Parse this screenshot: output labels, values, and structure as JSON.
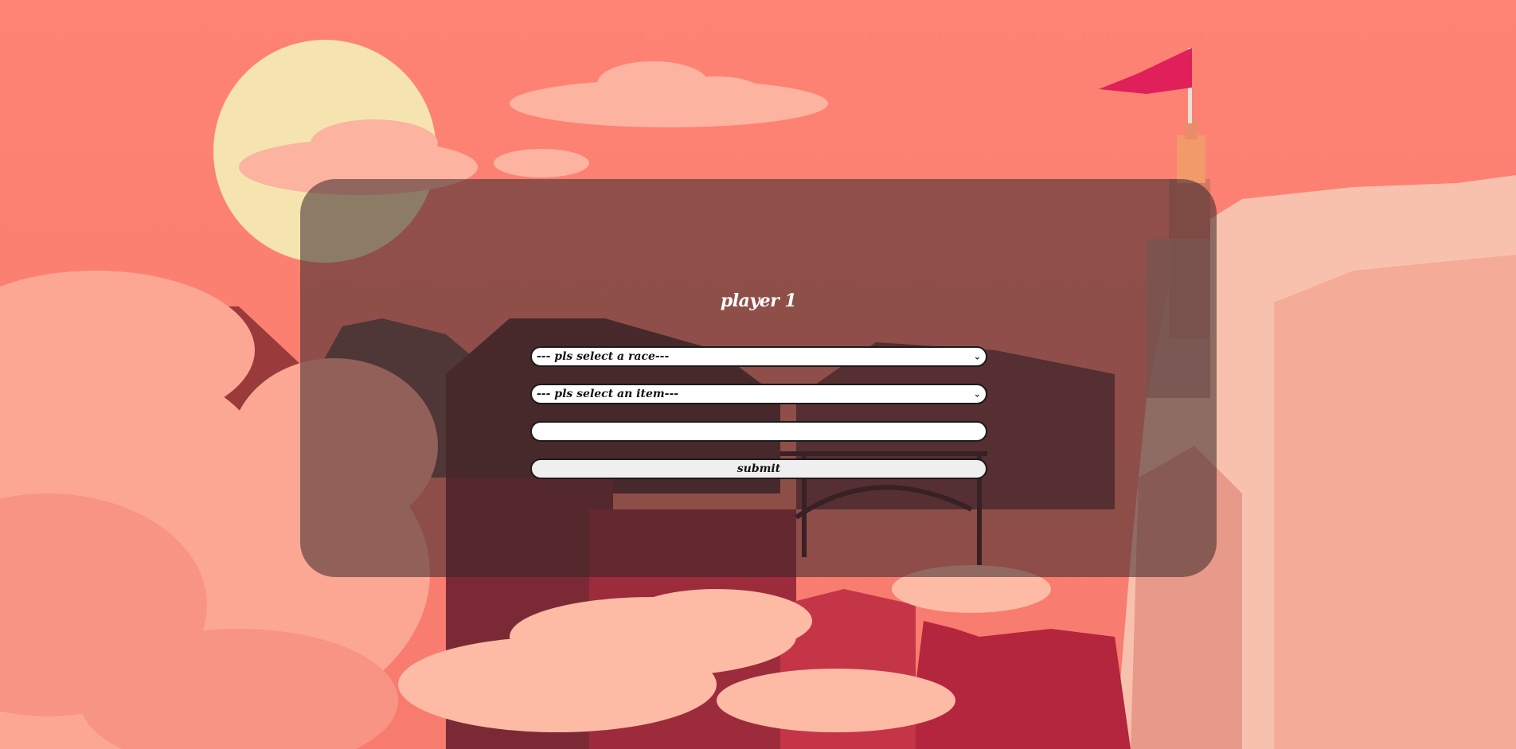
{
  "form": {
    "title": "player 1",
    "race_select": {
      "selected": "--- pls select a race---"
    },
    "item_select": {
      "selected": "--- pls select an item---"
    },
    "name_input": {
      "value": ""
    },
    "submit_label": "submit"
  },
  "colors": {
    "sky": "#fe8574",
    "sun": "#f5e4b0",
    "flag": "#e0205a",
    "panel_overlay": "rgba(55,38,40,0.55)"
  },
  "icons": {
    "select_arrow": "chevron-down-icon"
  }
}
